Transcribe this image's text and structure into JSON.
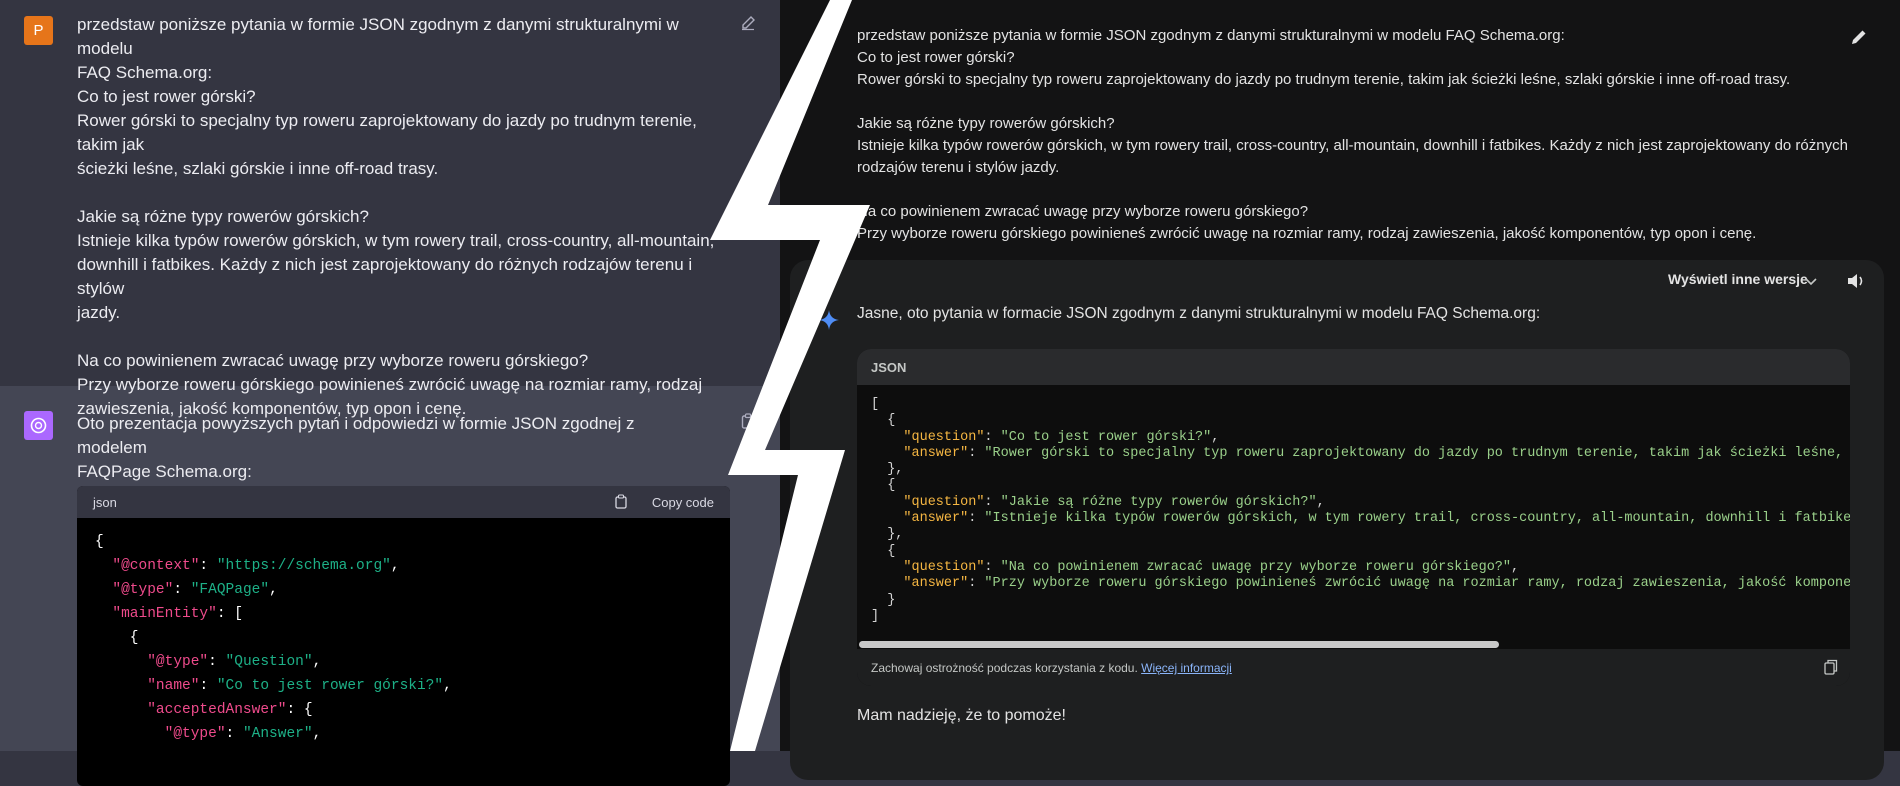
{
  "left": {
    "user_avatar": "P",
    "user_message": "przedstaw poniższe pytania w formie JSON zgodnym z danymi strukturalnymi w modelu\nFAQ Schema.org:\nCo to jest rower górski?\nRower górski to specjalny typ roweru zaprojektowany do jazdy po trudnym terenie, takim jak\nścieżki leśne, szlaki górskie i inne off-road trasy.\n\nJakie są różne typy rowerów górskich?\nIstnieje kilka typów rowerów górskich, w tym rowery trail, cross-country, all-mountain,\ndownhill i fatbikes. Każdy z nich jest zaprojektowany do różnych rodzajów terenu i stylów\njazdy.\n\nNa co powinienem zwracać uwagę przy wyborze roweru górskiego?\nPrzy wyborze roweru górskiego powinieneś zwrócić uwagę na rozmiar ramy, rodzaj\nzawieszenia, jakość komponentów, typ opon i cenę.",
    "bot_message": "Oto prezentacja powyższych pytań i odpowiedzi w formie JSON zgodnej z modelem\nFAQPage Schema.org:",
    "code_lang": "json",
    "copy_label": "Copy code",
    "code_lines": [
      [
        "{"
      ],
      [
        "  ",
        "\"@context\"",
        ": ",
        "\"https://schema.org\"",
        ","
      ],
      [
        "  ",
        "\"@type\"",
        ": ",
        "\"FAQPage\"",
        ","
      ],
      [
        "  ",
        "\"mainEntity\"",
        ": ["
      ],
      [
        "    {"
      ],
      [
        "      ",
        "\"@type\"",
        ": ",
        "\"Question\"",
        ","
      ],
      [
        "      ",
        "\"name\"",
        ": ",
        "\"Co to jest rower górski?\"",
        ","
      ],
      [
        "      ",
        "\"acceptedAnswer\"",
        ": {"
      ],
      [
        "        ",
        "\"@type\"",
        ": ",
        "\"Answer\"",
        ","
      ]
    ]
  },
  "right": {
    "user_message": "przedstaw poniższe pytania w formie JSON zgodnym z danymi strukturalnymi w modelu FAQ Schema.org:\nCo to jest rower górski?\nRower górski to specjalny typ roweru zaprojektowany do jazdy po trudnym terenie, takim jak ścieżki leśne, szlaki górskie i inne off-road trasy.\n\nJakie są różne typy rowerów górskich?\nIstnieje kilka typów rowerów górskich, w tym rowery trail, cross-country, all-mountain, downhill i fatbikes. Każdy z nich jest zaprojektowany do różnych\nrodzajów terenu i stylów jazdy.\n\nNa co powinienem zwracać uwagę przy wyborze roweru górskiego?\nPrzy wyborze roweru górskiego powinieneś zwrócić uwagę na rozmiar ramy, rodzaj zawieszenia, jakość komponentów, typ opon i cenę.",
    "versions_label": "Wyświetl inne wersje",
    "answer_intro": "Jasne, oto pytania w formacie JSON zgodnym z danymi strukturalnymi w modelu FAQ Schema.org:",
    "code_lang": "JSON",
    "code_lines": [
      [
        "["
      ],
      [
        "  {"
      ],
      [
        "    ",
        "\"question\"",
        ": ",
        "\"Co to jest rower górski?\"",
        ","
      ],
      [
        "    ",
        "\"answer\"",
        ": ",
        "\"Rower górski to specjalny typ roweru zaprojektowany do jazdy po trudnym terenie, takim jak ścieżki leśne, szlaki gó",
        ""
      ],
      [
        "  },"
      ],
      [
        "  {"
      ],
      [
        "    ",
        "\"question\"",
        ": ",
        "\"Jakie są różne typy rowerów górskich?\"",
        ","
      ],
      [
        "    ",
        "\"answer\"",
        ": ",
        "\"Istnieje kilka typów rowerów górskich, w tym rowery trail, cross-country, all-mountain, downhill i fatbikes. Każdy",
        ""
      ],
      [
        "  },"
      ],
      [
        "  {"
      ],
      [
        "    ",
        "\"question\"",
        ": ",
        "\"Na co powinienem zwracać uwagę przy wyborze roweru górskiego?\"",
        ","
      ],
      [
        "    ",
        "\"answer\"",
        ": ",
        "\"Przy wyborze roweru górskiego powinieneś zwrócić uwagę na rozmiar ramy, rodzaj zawieszenia, jakość komponentów, typ",
        ""
      ],
      [
        "  }"
      ],
      [
        "]"
      ]
    ],
    "code_note": "Zachowaj ostrożność podczas korzystania z kodu.",
    "code_note_link": "Więcej informacji",
    "closing": "Mam nadzieję, że to pomoże!"
  }
}
